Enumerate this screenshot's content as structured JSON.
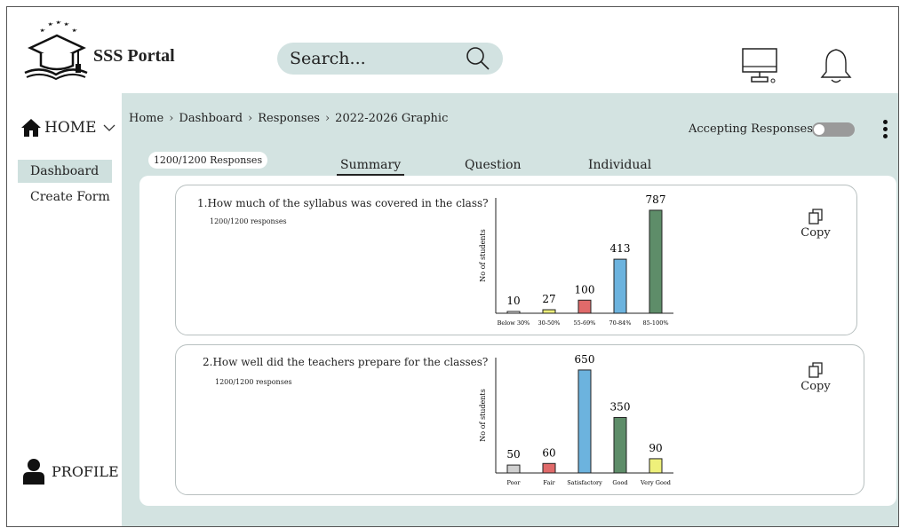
{
  "app": {
    "title": "SSS Portal"
  },
  "search": {
    "placeholder": "Search..."
  },
  "sidebar": {
    "home_label": "HOME",
    "items": [
      {
        "label": "Dashboard"
      },
      {
        "label": "Create Form"
      }
    ],
    "profile_label": "PROFILE"
  },
  "breadcrumb": [
    "Home",
    "Dashboard",
    "Responses",
    "2022-2026 Graphic"
  ],
  "header": {
    "accepting_label": "Accepting Responses",
    "accepting_on": false
  },
  "summary": {
    "responses_pill": "1200/1200 Responses"
  },
  "tabs": [
    {
      "label": "Summary",
      "active": true
    },
    {
      "label": "Question"
    },
    {
      "label": "Individual"
    }
  ],
  "questions": [
    {
      "title": "1.How much of the syllabus was covered in the class?",
      "responses": "1200/1200 responses",
      "copy_label": "Copy"
    },
    {
      "title": "2.How well did the teachers prepare for the classes?",
      "responses": "1200/1200 responses",
      "copy_label": "Copy"
    }
  ],
  "chart_data": [
    {
      "type": "bar",
      "categories": [
        "Below 30%",
        "30-50%",
        "55-69%",
        "70-84%",
        "85-100%"
      ],
      "values": [
        10,
        27,
        100,
        413,
        787
      ],
      "colors": [
        "#ffffff",
        "#eef07a",
        "#e06a6a",
        "#6cb3de",
        "#5e8d69"
      ],
      "ylabel": "No of students",
      "xlabel": "",
      "data_labels": true
    },
    {
      "type": "bar",
      "categories": [
        "Poor",
        "Fair",
        "Satisfactory",
        "Good",
        "Very Good"
      ],
      "values": [
        50,
        60,
        650,
        350,
        90
      ],
      "colors": [
        "#d0d0d0",
        "#e06a6a",
        "#6cb3de",
        "#5e8d69",
        "#eef07a"
      ],
      "ylabel": "No of students",
      "xlabel": "",
      "data_labels": true
    }
  ]
}
